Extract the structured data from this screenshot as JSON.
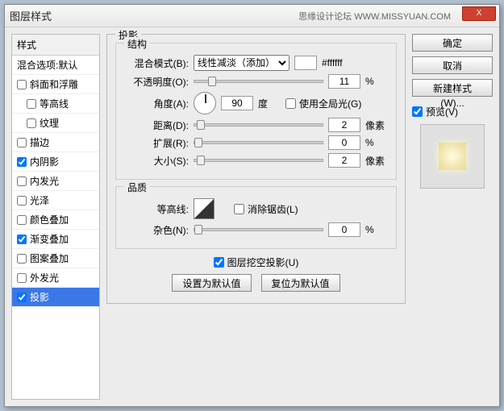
{
  "window": {
    "title": "图层样式",
    "brand": "思缘设计论坛 WWW.MISSYUAN.COM",
    "close": "X"
  },
  "sidebar": {
    "head": "样式",
    "blend": "混合选项:默认",
    "items": [
      {
        "label": "斜面和浮雕",
        "checked": false
      },
      {
        "label": "等高线",
        "checked": false,
        "sub": true
      },
      {
        "label": "纹理",
        "checked": false,
        "sub": true
      },
      {
        "label": "描边",
        "checked": false
      },
      {
        "label": "内阴影",
        "checked": true
      },
      {
        "label": "内发光",
        "checked": false
      },
      {
        "label": "光泽",
        "checked": false
      },
      {
        "label": "颜色叠加",
        "checked": false
      },
      {
        "label": "渐变叠加",
        "checked": true
      },
      {
        "label": "图案叠加",
        "checked": false
      },
      {
        "label": "外发光",
        "checked": false
      },
      {
        "label": "投影",
        "checked": true,
        "selected": true
      }
    ]
  },
  "panel": {
    "title": "投影",
    "struct": {
      "legend": "结构",
      "blend_label": "混合模式(B):",
      "blend_mode": "线性减淡（添加）",
      "hex": "#ffffff",
      "opacity_label": "不透明度(O):",
      "opacity": "11",
      "pct": "%",
      "angle_label": "角度(A):",
      "angle": "90",
      "deg": "度",
      "global_light": "使用全局光(G)",
      "distance_label": "距离(D):",
      "distance": "2",
      "px": "像素",
      "spread_label": "扩展(R):",
      "spread": "0",
      "size_label": "大小(S):",
      "size": "2"
    },
    "quality": {
      "legend": "品质",
      "contour_label": "等高线:",
      "antialias": "消除锯齿(L)",
      "noise_label": "杂色(N):",
      "noise": "0"
    },
    "knockout": "图层挖空投影(U)",
    "set_default": "设置为默认值",
    "reset_default": "复位为默认值"
  },
  "right": {
    "ok": "确定",
    "cancel": "取消",
    "new_style": "新建样式(W)...",
    "preview": "预览(V)"
  }
}
